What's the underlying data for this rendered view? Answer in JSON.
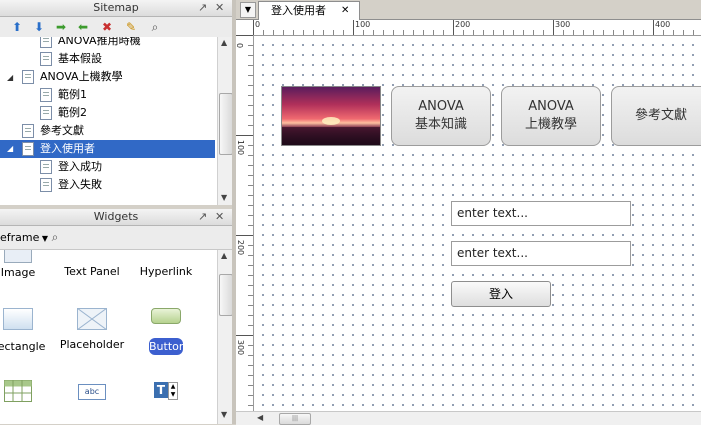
{
  "sitemap": {
    "title": "Sitemap",
    "items": [
      {
        "label": "ANOVA推用時機",
        "level": 2
      },
      {
        "label": "基本假設",
        "level": 2
      },
      {
        "label": "ANOVA上機教學",
        "level": 1
      },
      {
        "label": "範例1",
        "level": 2
      },
      {
        "label": "範例2",
        "level": 2
      },
      {
        "label": "參考文獻",
        "level": 1
      },
      {
        "label": "登入使用者",
        "level": 1,
        "selected": true
      },
      {
        "label": "登入成功",
        "level": 2
      },
      {
        "label": "登入失敗",
        "level": 2
      }
    ]
  },
  "widgets": {
    "title": "Widgets",
    "library": "eframe",
    "items": [
      {
        "label": "Image"
      },
      {
        "label": "Text Panel"
      },
      {
        "label": "Hyperlink"
      },
      {
        "label": "Rectangle"
      },
      {
        "label": "Placeholder"
      },
      {
        "label": "Button"
      }
    ],
    "text_field_icon": "abc"
  },
  "tab": {
    "label": "登入使用者"
  },
  "ruler": {
    "marks": [
      "0",
      "100",
      "200",
      "300",
      "400"
    ]
  },
  "canvas": {
    "nav_buttons": [
      {
        "line1": "ANOVA",
        "line2": "基本知識"
      },
      {
        "line1": "ANOVA",
        "line2": "上機教學"
      },
      {
        "line1": "參考文獻",
        "line2": ""
      }
    ],
    "field1_text": "enter text...",
    "field2_text": "enter text...",
    "login_label": "登入"
  },
  "colors": {
    "selected": "#3169c6",
    "widget_button": "#3c5fcf"
  }
}
